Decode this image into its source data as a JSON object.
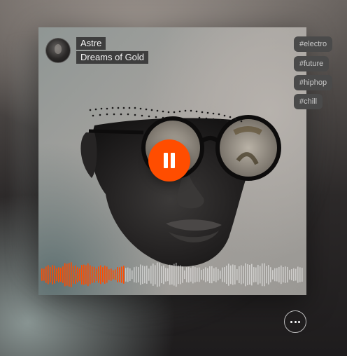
{
  "player": {
    "artist": "Astre",
    "title": "Dreams of Gold",
    "tags": [
      "#electro",
      "#future",
      "#hiphop",
      "#chill"
    ],
    "state": "playing",
    "progress": 0.32,
    "accent_color": "#ff4d00",
    "controls": {
      "pause_icon": "pause-icon",
      "more_icon": "ellipsis-icon"
    }
  }
}
